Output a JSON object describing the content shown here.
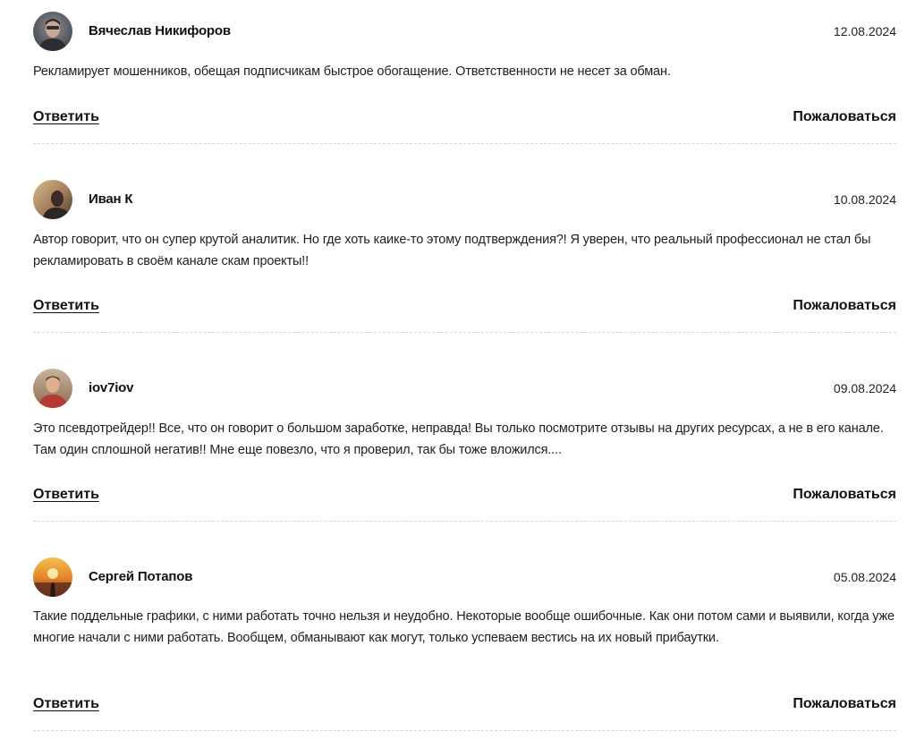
{
  "comments": [
    {
      "author": "Вячеслав Никифоров",
      "date": "12.08.2024",
      "text": "Рекламирует мошенников, обещая подписчикам быстрое обогащение. Ответственности не несет за обман.",
      "reply_label": "Ответить",
      "report_label": "Пожаловаться"
    },
    {
      "author": "Иван К",
      "date": "10.08.2024",
      "text": "Автор говорит, что он супер крутой аналитик. Но где хоть каике-то этому подтверждения?! Я уверен, что реальный профессионал не стал бы рекламировать в своём канале скам проекты!!",
      "reply_label": "Ответить",
      "report_label": "Пожаловаться"
    },
    {
      "author": "iov7iov",
      "date": "09.08.2024",
      "text": "Это псевдотрейдер!! Все, что он говорит о большом заработке, неправда! Вы только посмотрите отзывы на других ресурсах, а не в его канале. Там один сплошной негатив!! Мне еще повезло, что я проверил, так бы тоже вложился....",
      "reply_label": "Ответить",
      "report_label": "Пожаловаться"
    },
    {
      "author": "Сергей Потапов",
      "date": "05.08.2024",
      "text": "Такие поддельные графики, с ними работать точно нельзя и неудобно. Некоторые вообще ошибочные. Как они потом сами и выявили, когда уже многие начали с ними работать. Вообщем, обманывают как могут, только успеваем вестись на их новый прибаутки.",
      "reply_label": "Ответить",
      "report_label": "Пожаловаться"
    }
  ]
}
